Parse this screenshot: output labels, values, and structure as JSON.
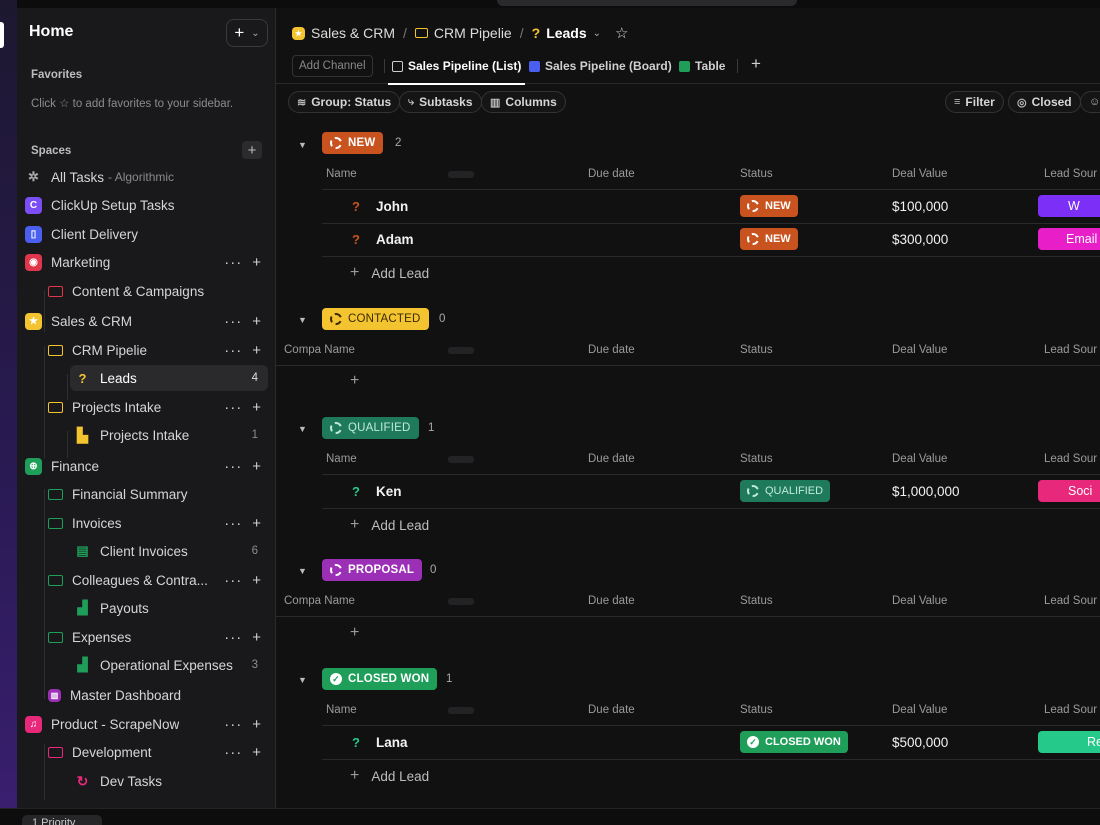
{
  "sidebar": {
    "home": "Home",
    "favorites_title": "Favorites",
    "favorites_hint_prefix": "Click",
    "favorites_hint_suffix": "to add favorites to your sidebar.",
    "spaces_title": "Spaces",
    "items": [
      {
        "label": "All Tasks",
        "sub": "- Algorithmic"
      },
      {
        "label": "ClickUp Setup Tasks",
        "icon_letter": "C"
      },
      {
        "label": "Client Delivery"
      },
      {
        "label": "Marketing"
      },
      {
        "label": "Content & Campaigns"
      },
      {
        "label": "Sales & CRM"
      },
      {
        "label": "CRM Pipelie"
      },
      {
        "label": "Leads",
        "count": "4"
      },
      {
        "label": "Projects Intake"
      },
      {
        "label": "Projects Intake",
        "count": "1"
      },
      {
        "label": "Finance"
      },
      {
        "label": "Financial Summary"
      },
      {
        "label": "Invoices"
      },
      {
        "label": "Client Invoices",
        "count": "6"
      },
      {
        "label": "Colleagues & Contra..."
      },
      {
        "label": "Payouts"
      },
      {
        "label": "Expenses"
      },
      {
        "label": "Operational Expenses",
        "count": "3"
      },
      {
        "label": "Master Dashboard"
      },
      {
        "label": "Product - ScrapeNow"
      },
      {
        "label": "Development"
      },
      {
        "label": "Dev Tasks"
      }
    ]
  },
  "breadcrumb": {
    "space": "Sales & CRM",
    "folder": "CRM Pipelie",
    "list": "Leads"
  },
  "views": {
    "add_channel": "Add Channel",
    "tabs": [
      "Sales Pipeline (List)",
      "Sales Pipeline (Board)",
      "Table"
    ]
  },
  "toolbar": {
    "group": "Group: Status",
    "subtasks": "Subtasks",
    "columns": "Columns",
    "filter": "Filter",
    "closed": "Closed"
  },
  "columns": {
    "name": "Name",
    "name_alt": "Compa Name",
    "due": "Due date",
    "status": "Status",
    "deal": "Deal Value",
    "source": "Lead Sour"
  },
  "add_lead": "Add Lead",
  "groups": [
    {
      "status": "NEW",
      "count": "2",
      "color": "#c8531f",
      "rows": [
        {
          "name": "John",
          "status": "NEW",
          "deal": "$100,000",
          "source": "W",
          "source_color": "#7b2ff7"
        },
        {
          "name": "Adam",
          "status": "NEW",
          "deal": "$300,000",
          "source": "Email",
          "source_color": "#e81ec8"
        }
      ]
    },
    {
      "status": "CONTACTED",
      "count": "0",
      "color": "#f4c430",
      "rows": []
    },
    {
      "status": "QUALIFIED",
      "count": "1",
      "color": "#1f7a5c",
      "rows": [
        {
          "name": "Ken",
          "status": "QUALIFIED",
          "deal": "$1,000,000",
          "source": "Soci",
          "source_color": "#e8287a"
        }
      ]
    },
    {
      "status": "PROPOSAL",
      "count": "0",
      "color": "#9b2fb5",
      "rows": []
    },
    {
      "status": "CLOSED WON",
      "count": "1",
      "color": "#1f9e5a",
      "rows": [
        {
          "name": "Lana",
          "status": "CLOSED WON",
          "deal": "$500,000",
          "source": "Re",
          "source_color": "#25c98a"
        }
      ]
    }
  ],
  "bottom": {
    "priority": "1 Priority"
  }
}
